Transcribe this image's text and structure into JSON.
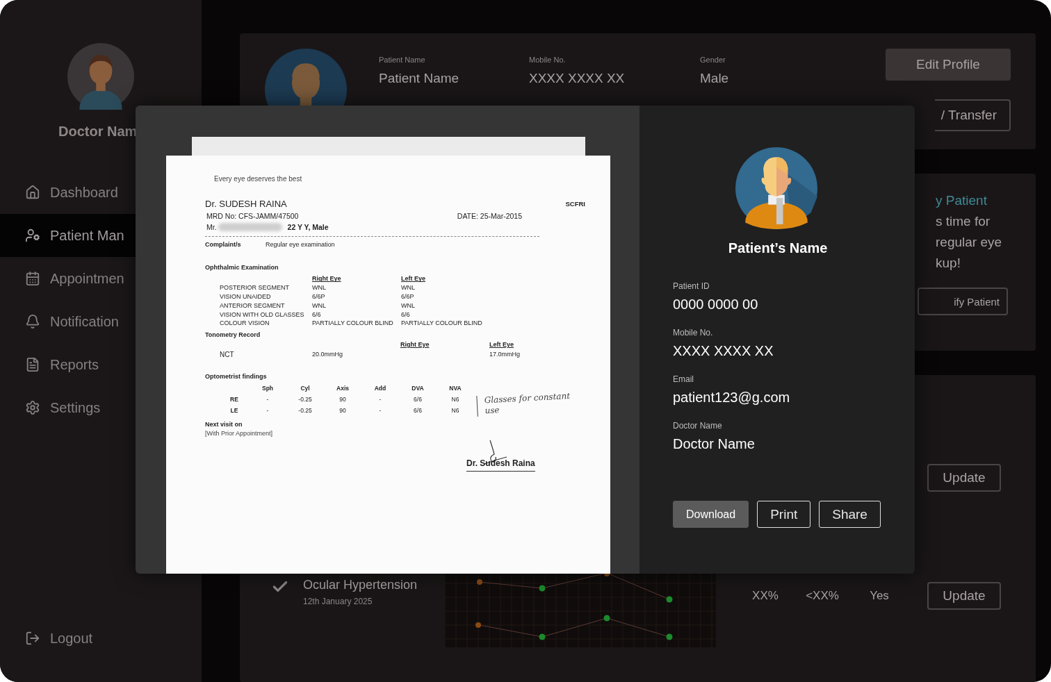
{
  "sidebar": {
    "profile_name": "Doctor Nam",
    "items": [
      {
        "label": "Dashboard",
        "selected": false
      },
      {
        "label": "Patient Man",
        "selected": true
      },
      {
        "label": "Appointmen",
        "selected": false
      },
      {
        "label": "Notification",
        "selected": false
      },
      {
        "label": "Reports",
        "selected": false
      },
      {
        "label": "Settings",
        "selected": false
      }
    ],
    "logout": "Logout"
  },
  "profile_card": {
    "fields": [
      {
        "label": "Patient Name",
        "value": "Patient Name"
      },
      {
        "label": "Mobile No.",
        "value": "XXXX XXXX XX"
      },
      {
        "label": "Gender",
        "value": "Male"
      }
    ],
    "buttons": [
      {
        "label": "Edit Profile",
        "kind": "filled"
      },
      {
        "label": "/ Transfer",
        "kind": "outline"
      }
    ]
  },
  "reminder_card": {
    "title": "y Patient",
    "lines": [
      "s time for",
      "regular eye",
      "kup!"
    ],
    "button": "ify Patient"
  },
  "records_card": {
    "update_buttons": [
      "Update",
      "Update"
    ],
    "entry": {
      "title": "Ocular Hypertension",
      "date": "12th January 2025",
      "stats": [
        "XX%",
        "<XX%",
        "Yes"
      ]
    }
  },
  "report_modal": {
    "document": {
      "tagline": "Every eye deserves the best",
      "doctor": "Dr. SUDESH RAINA",
      "clinic": "SCFRI",
      "mrd": "MRD No:  CFS-JAMM/47500",
      "date": "DATE:  25-Mar-2015",
      "patient_prefix": "Mr.",
      "patient_info": "22 Y Y,  Male",
      "complaint": {
        "label": "Complaint/s",
        "value": "Regular eye examination"
      },
      "exam": {
        "title": "Ophthalmic Examination",
        "columns": [
          "Right Eye",
          "Left Eye"
        ],
        "rows": [
          {
            "label": "POSTERIOR SEGMENT",
            "right": "WNL",
            "left": "WNL"
          },
          {
            "label": "VISION UNAIDED",
            "right": "6/6P",
            "left": "6/6P"
          },
          {
            "label": "ANTERIOR SEGMENT",
            "right": "WNL",
            "left": "WNL"
          },
          {
            "label": "VISION WITH OLD GLASSES",
            "right": "6/6",
            "left": "6/6"
          },
          {
            "label": "COLOUR VISION",
            "right": "PARTIALLY COLOUR BLIND",
            "left": "PARTIALLY COLOUR BLIND"
          }
        ]
      },
      "tonometry": {
        "title": "Tonometry Record",
        "columns": [
          "Right Eye",
          "Left Eye"
        ],
        "rows": [
          {
            "label": "NCT",
            "right": "20.0mmHg",
            "left": "17.0mmHg"
          }
        ]
      },
      "optometry": {
        "title": "Optometrist findings",
        "columns": [
          "Sph",
          "Cyl",
          "Axis",
          "Add",
          "DVA",
          "NVA"
        ],
        "rows": [
          {
            "label": "RE",
            "values": [
              "-",
              "-0.25",
              "90",
              "-",
              "6/6",
              "N6"
            ]
          },
          {
            "label": "LE",
            "values": [
              "-",
              "-0.25",
              "90",
              "-",
              "6/6",
              "N6"
            ]
          }
        ]
      },
      "note": "Glasses for constant use",
      "next_visit": {
        "title": "Next visit on",
        "value": "[With Prior Appointment]"
      },
      "signature": "Dr. Sudesh Raina"
    },
    "patient": {
      "name": "Patient’s Name",
      "fields": [
        {
          "label": "Patient ID",
          "value": "0000 0000 00"
        },
        {
          "label": "Mobile No.",
          "value": "XXXX XXXX XX"
        },
        {
          "label": "Email",
          "value": "patient123@g.com"
        },
        {
          "label": "Doctor Name",
          "value": "Doctor Name"
        }
      ],
      "buttons": [
        {
          "label": "Download",
          "kind": "filled"
        },
        {
          "label": "Print",
          "kind": "outline"
        },
        {
          "label": "Share",
          "kind": "outline"
        }
      ]
    }
  }
}
